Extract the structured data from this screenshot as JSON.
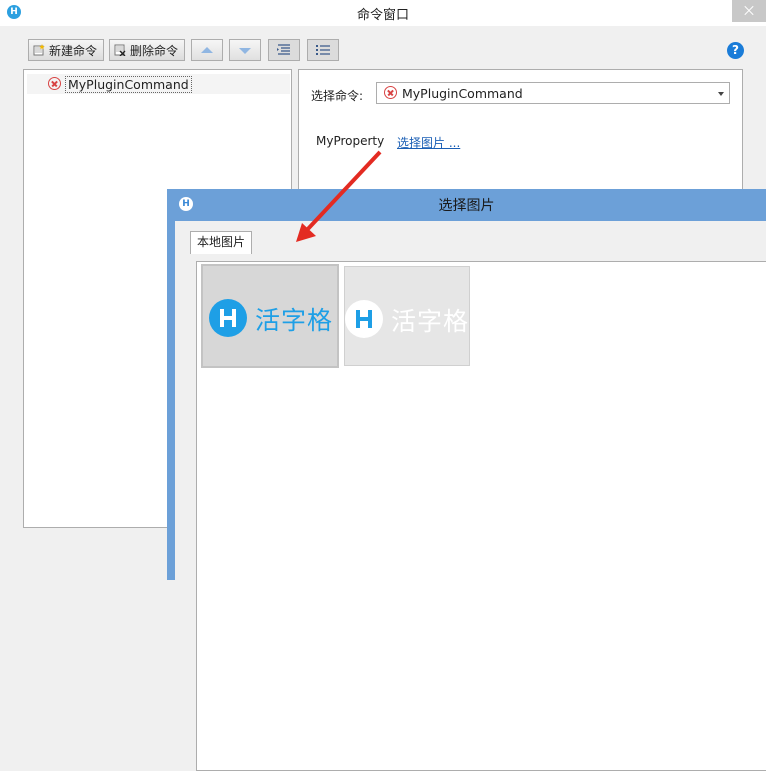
{
  "window": {
    "title": "命令窗口",
    "app_icon": "H"
  },
  "toolbar": {
    "new_label": "新建命令",
    "delete_label": "删除命令",
    "new_icon": "new-command-icon",
    "delete_icon": "delete-command-icon",
    "up_icon": "arrow-up-icon",
    "down_icon": "arrow-down-icon",
    "indent_icon": "indent-icon",
    "outdent_icon": "outdent-icon",
    "help_icon": "help-icon",
    "help_glyph": "?"
  },
  "tree": {
    "items": [
      {
        "label": "MyPluginCommand",
        "icon": "error-icon"
      }
    ]
  },
  "properties": {
    "select_label": "选择命令:",
    "select_value": "MyPluginCommand",
    "property_name": "MyProperty",
    "property_link": "选择图片 ..."
  },
  "dialog": {
    "title": "选择图片",
    "app_icon": "H",
    "tab_label": "本地图片",
    "images": [
      {
        "text": "活字格",
        "logo_glyph": "H",
        "style": "blue",
        "selected": true
      },
      {
        "text": "活字格",
        "logo_glyph": "H",
        "style": "white",
        "selected": false
      }
    ]
  },
  "colors": {
    "accent": "#1e9fe6",
    "dialog_title": "#6ca0d8",
    "error": "#d84343",
    "link": "#1b5fb5"
  }
}
